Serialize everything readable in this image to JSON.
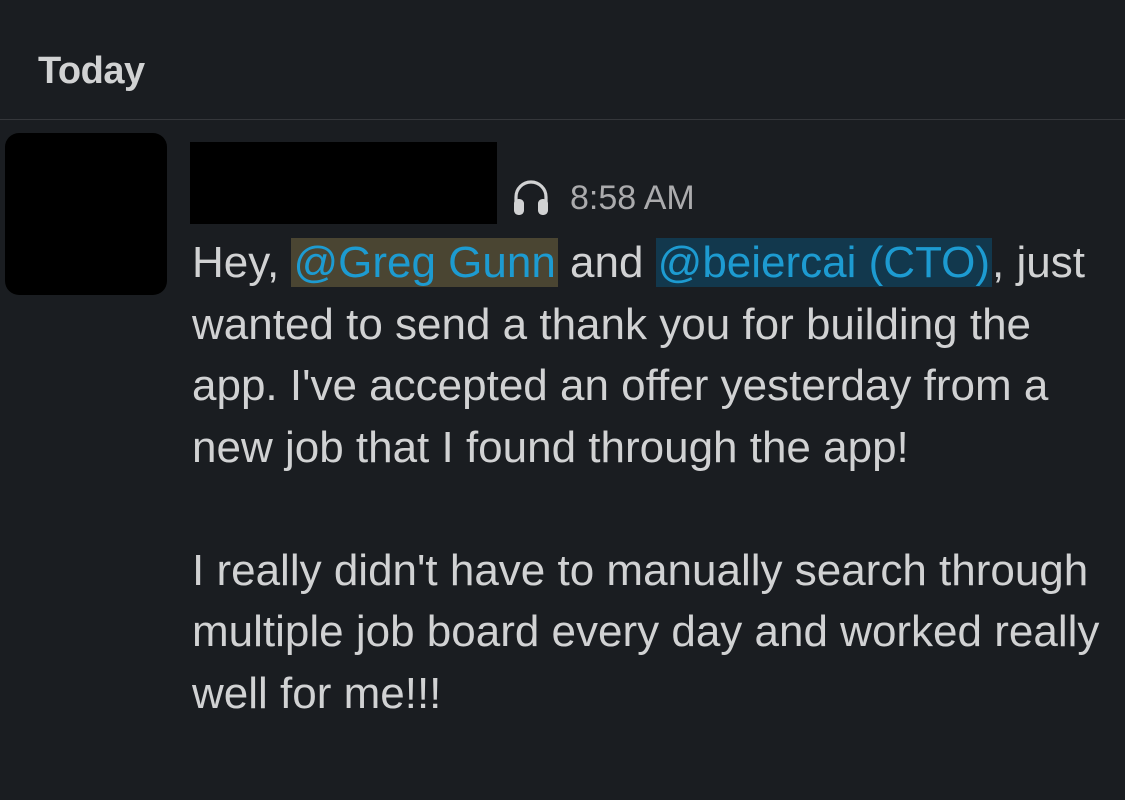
{
  "header": {
    "day_label": "Today"
  },
  "message": {
    "status_icon": "headphones-icon",
    "timestamp": "8:58 AM",
    "greeting": "Hey, ",
    "mention_1": "@Greg Gunn",
    "conjunction": " and ",
    "mention_2": "@beiercai (CTO)",
    "para1_rest": ", just wanted to send a thank you for building the app. I've accepted an offer yesterday from a new job that I found through the app!",
    "para2": "I really didn't have to manually search through multiple job board every day and worked really well for me!!!"
  },
  "colors": {
    "background": "#1a1d21",
    "text": "#d1d2d3",
    "muted": "#ababad",
    "mention_text": "#1d9bd1",
    "mention_self_bg": "#4a4532",
    "mention_other_bg": "#12384d"
  }
}
